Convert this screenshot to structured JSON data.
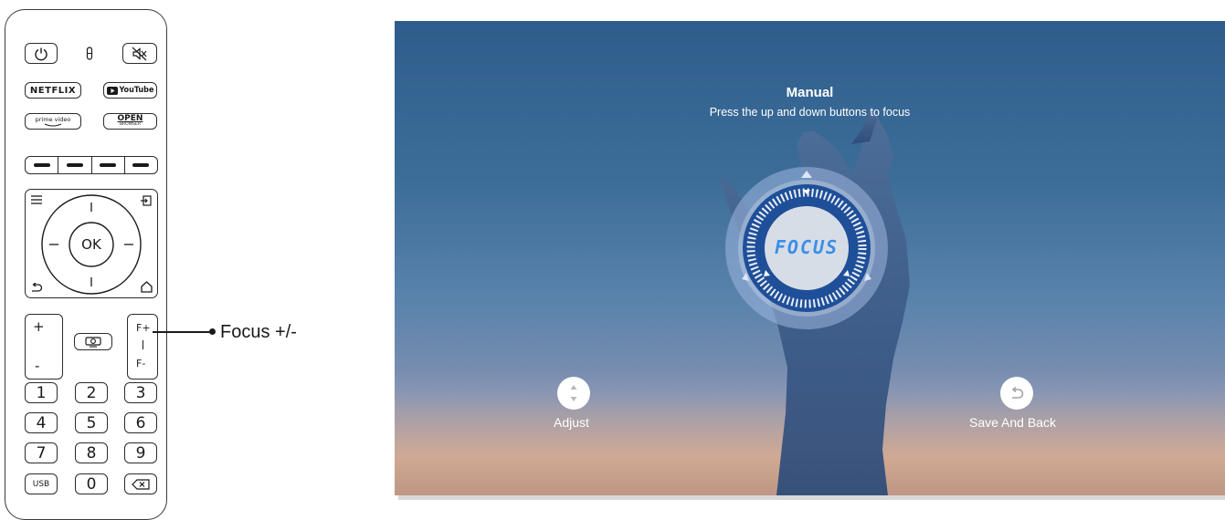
{
  "remote": {
    "netflix_label": "NETFLIX",
    "youtube_label": "YouTube",
    "prime_label": "prime video",
    "open_label": "OPEN",
    "open_sub_label": "BROWSER",
    "ok_label": "OK",
    "vol_plus": "+",
    "vol_minus": "-",
    "focus_plus": "F+",
    "focus_minus": "F-",
    "numbers": [
      "1",
      "2",
      "3",
      "4",
      "5",
      "6",
      "7",
      "8",
      "9"
    ],
    "usb_label": "USB",
    "zero_label": "0"
  },
  "callout": {
    "text": "Focus +/-"
  },
  "screen": {
    "title": "Manual",
    "subtitle": "Press the up and down buttons to focus",
    "dial_label": "FOCUS",
    "adjust_label": "Adjust",
    "save_back_label": "Save And Back"
  },
  "colors": {
    "dial_blue": "#1f4f99",
    "focus_text": "#3a8ee8",
    "outline": "#2b2b2b"
  }
}
